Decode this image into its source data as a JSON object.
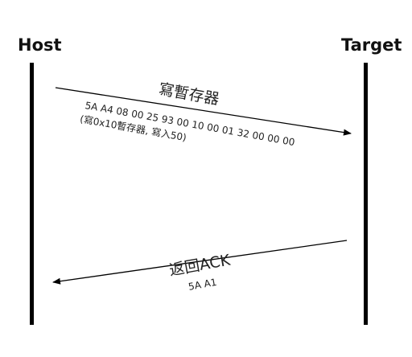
{
  "participants": {
    "host": "Host",
    "target": "Target"
  },
  "messages": [
    {
      "title": "寫暫存器",
      "bytes": "5A A4 08 00 25 93 00 10 00 01 32 00 00 00",
      "note": "(寫0x10暫存器, 寫入50)",
      "direction": "host-to-target"
    },
    {
      "title": "返回ACK",
      "bytes": "5A A1",
      "direction": "target-to-host"
    }
  ],
  "colors": {
    "line": "#000000",
    "text": "#222222",
    "background": "#ffffff"
  }
}
